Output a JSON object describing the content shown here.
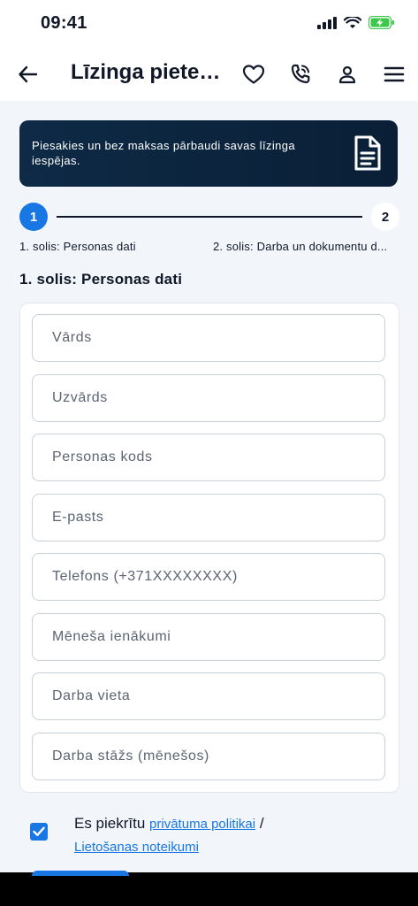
{
  "status_bar": {
    "time": "09:41"
  },
  "header": {
    "title": "Līzinga pietei..."
  },
  "banner": {
    "text": "Piesakies un bez maksas pārbaudi savas līzinga iespējas."
  },
  "stepper": {
    "steps": [
      {
        "number": "1",
        "label": "1. solis: Personas dati",
        "active": true
      },
      {
        "number": "2",
        "label": "2. solis: Darba un dokumentu d...",
        "active": false
      }
    ]
  },
  "section": {
    "title": "1. solis: Personas dati"
  },
  "form": {
    "fields": [
      {
        "placeholder": "Vārds"
      },
      {
        "placeholder": "Uzvārds"
      },
      {
        "placeholder": "Personas kods"
      },
      {
        "placeholder": "E-pasts"
      },
      {
        "placeholder": "Telefons (+371XXXXXXXX)"
      },
      {
        "placeholder": "Mēneša ienākumi"
      },
      {
        "placeholder": "Darba vieta"
      },
      {
        "placeholder": "Darba stāžs (mēnešos)"
      }
    ]
  },
  "consent": {
    "checked": true,
    "prefix": "Es piekrītu",
    "privacy_link": "privātuma politikai",
    "separator": "/",
    "terms_link": "Lietošanas noteikumi"
  },
  "colors": {
    "accent": "#1877e3",
    "banner": "#0e2a46",
    "background": "#f2f6fb"
  }
}
